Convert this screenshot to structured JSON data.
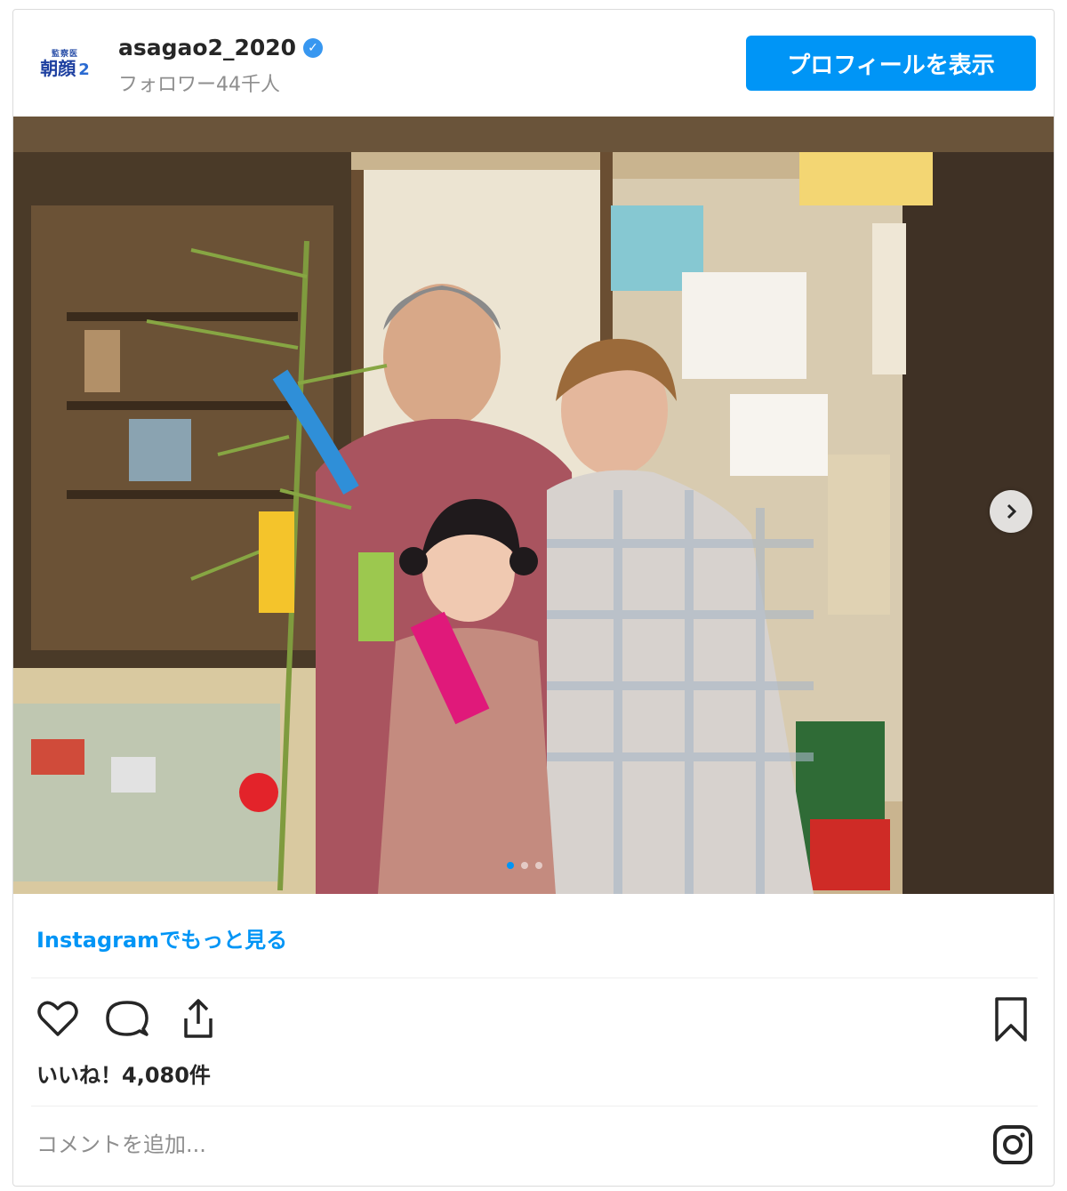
{
  "header": {
    "avatar_small": "監察医",
    "avatar_big": "朝顔",
    "avatar_num": "2",
    "username": "asagao2_2020",
    "verified_mark": "✓",
    "followers": "フォロワー44千人",
    "profile_button": "プロフィールを表示"
  },
  "post": {
    "carousel_dots": 3,
    "active_dot": 0,
    "more_link": "Instagramでもっと見る",
    "likes": "いいね！4,080件",
    "comment_placeholder": "コメントを追加..."
  },
  "icons": [
    "heart-icon",
    "comment-icon",
    "share-icon",
    "bookmark-icon",
    "instagram-icon",
    "chevron-right-icon"
  ],
  "colors": {
    "accent": "#0095f6",
    "verified": "#3897f0",
    "text": "#262626",
    "muted": "#8e8e8e"
  }
}
